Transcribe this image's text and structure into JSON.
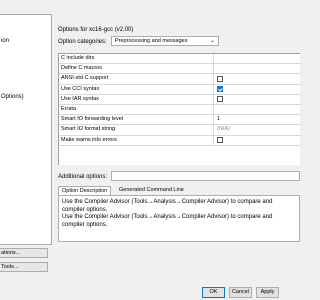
{
  "left_panel": {
    "items": [
      "ion",
      "Options)"
    ],
    "buttons": [
      "ations...",
      "Tools..."
    ]
  },
  "header": {
    "title": "Options for xc16-gcc (v2.00)"
  },
  "option_categories": {
    "label": "Option categories:",
    "selected": "Preprocessing and messages"
  },
  "options": [
    {
      "name": "C include dirs",
      "type": "text",
      "value": ""
    },
    {
      "name": "Define C macros",
      "type": "text",
      "value": ""
    },
    {
      "name": "ANSI-std C support",
      "type": "checkbox",
      "checked": false
    },
    {
      "name": "Use CCI syntax",
      "type": "checkbox",
      "checked": true
    },
    {
      "name": "Use IAR syntax",
      "type": "checkbox",
      "checked": false
    },
    {
      "name": "Errata",
      "type": "text",
      "value": ""
    },
    {
      "name": "Smart IO forwarding level",
      "type": "text",
      "value": "1"
    },
    {
      "name": "Smart IO format string",
      "type": "muted",
      "value": "(N/A)"
    },
    {
      "name": "Make warns into errors",
      "type": "checkbox",
      "checked": false
    }
  ],
  "additional_options": {
    "label": "Additional options:",
    "value": ""
  },
  "tabs": {
    "option_description": "Option Description",
    "generated_command_line": "Generated Command Line"
  },
  "description_text": "Use the Compiler Advisor (Tools→Analysis→Compiler Advisor) to compare and compiler options.\nUse the Compiler Advisor (Tools→Analysis→Compiler Advisor) to compare and compiler options.",
  "buttons": {
    "ok": "OK",
    "cancel": "Cancel",
    "apply": "Apply"
  }
}
